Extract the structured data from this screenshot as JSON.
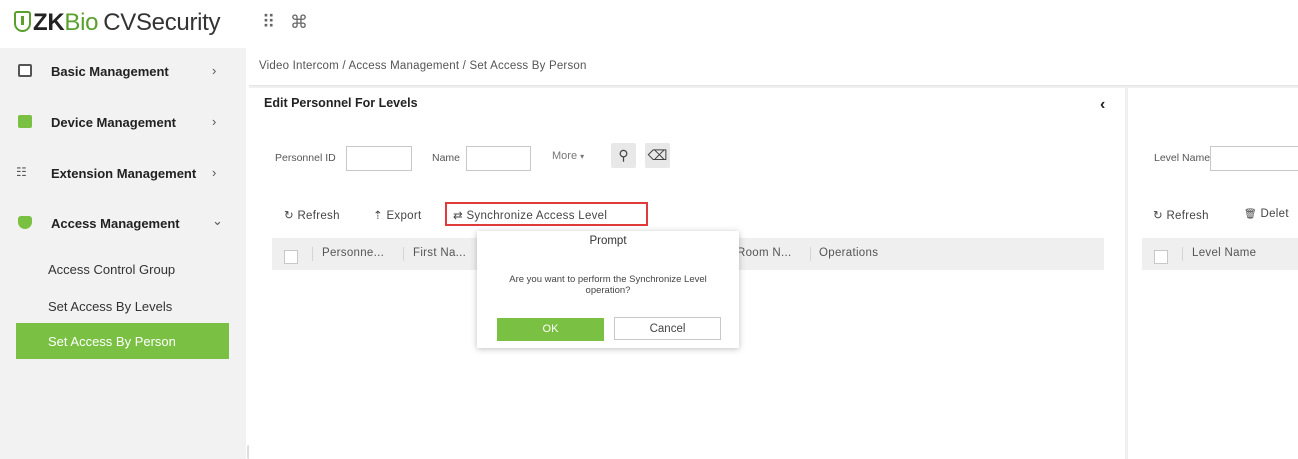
{
  "app": {
    "logo_prefix": "ZK",
    "logo_bio": "Bio",
    "logo_product": "CVSecurity",
    "apps_icon": "⠿",
    "command_icon": "⌘"
  },
  "sidebar": {
    "items": [
      {
        "label": "Basic Management",
        "icon": "list-icon",
        "arrow": "›"
      },
      {
        "label": "Device Management",
        "icon": "device-icon",
        "arrow": "›"
      },
      {
        "label": "Extension Management",
        "icon": "hierarchy-icon",
        "arrow": "›"
      },
      {
        "label": "Access Management",
        "icon": "shield-icon",
        "arrow": "⌄"
      }
    ],
    "sub_items": [
      "Access Control Group",
      "Set Access By Levels",
      "Set Access By Person"
    ],
    "active_sub": "Set Access By Person",
    "accent_color": "#7ac143"
  },
  "breadcrumb": "Video Intercom / Access Management / Set Access By Person",
  "left_panel": {
    "title": "Edit Personnel For Levels",
    "collapse_icon": "‹",
    "filters": {
      "personnel_id_label": "Personnel ID",
      "personnel_id_value": "",
      "name_label": "Name",
      "name_value": "",
      "more_label": "More",
      "more_caret": "▾",
      "search_icon": "⚲",
      "clear_icon": "⌫"
    },
    "toolbar": {
      "refresh": "Refresh",
      "refresh_icon": "↻",
      "export": "Export",
      "export_icon": "⇡",
      "sync": "Synchronize Access Level",
      "sync_icon": "⇄"
    },
    "columns": [
      "Personne...",
      "First Na...",
      "Room N...",
      "Operations"
    ]
  },
  "right_panel": {
    "filters": {
      "level_name_label": "Level Name",
      "level_name_value": ""
    },
    "toolbar": {
      "refresh": "Refresh",
      "refresh_icon": "↻",
      "delete": "Delet",
      "delete_icon": "🗑"
    },
    "columns": [
      "Level Name"
    ]
  },
  "dialog": {
    "title": "Prompt",
    "message_line1": "Are you want to perform the Synchronize Level",
    "message_line2": "operation?",
    "ok": "OK",
    "cancel": "Cancel"
  }
}
